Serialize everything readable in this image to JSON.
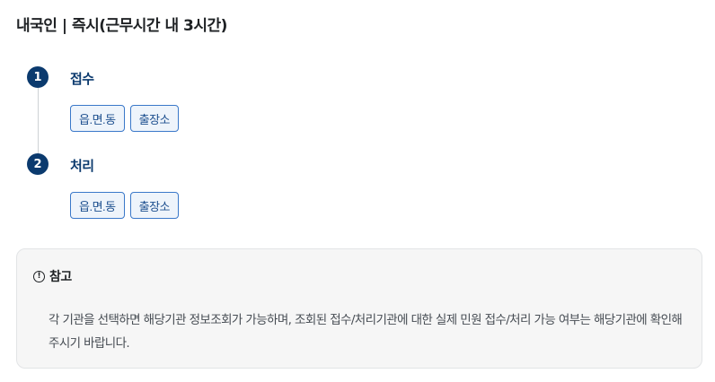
{
  "page": {
    "title": "내국인 | 즉시(근무시간 내 3시간)"
  },
  "steps": [
    {
      "number": "1",
      "title": "접수",
      "tags": [
        "읍.면.동",
        "출장소"
      ]
    },
    {
      "number": "2",
      "title": "처리",
      "tags": [
        "읍.면.동",
        "출장소"
      ]
    }
  ],
  "notice": {
    "icon": "info-circle-icon",
    "icon_glyph": "!",
    "title": "참고",
    "body": "각 기관을 선택하면 해당기관 정보조회가 가능하며, 조회된 접수/처리기관에 대한 실제 민원 접수/처리 가능 여부는 해당기관에 확인해 주시기 바랍니다."
  },
  "colors": {
    "primary": "#0b3a6e",
    "tag_border": "#3a78c9",
    "tag_bg": "#eef4fb",
    "notice_bg": "#f6f6f6"
  }
}
